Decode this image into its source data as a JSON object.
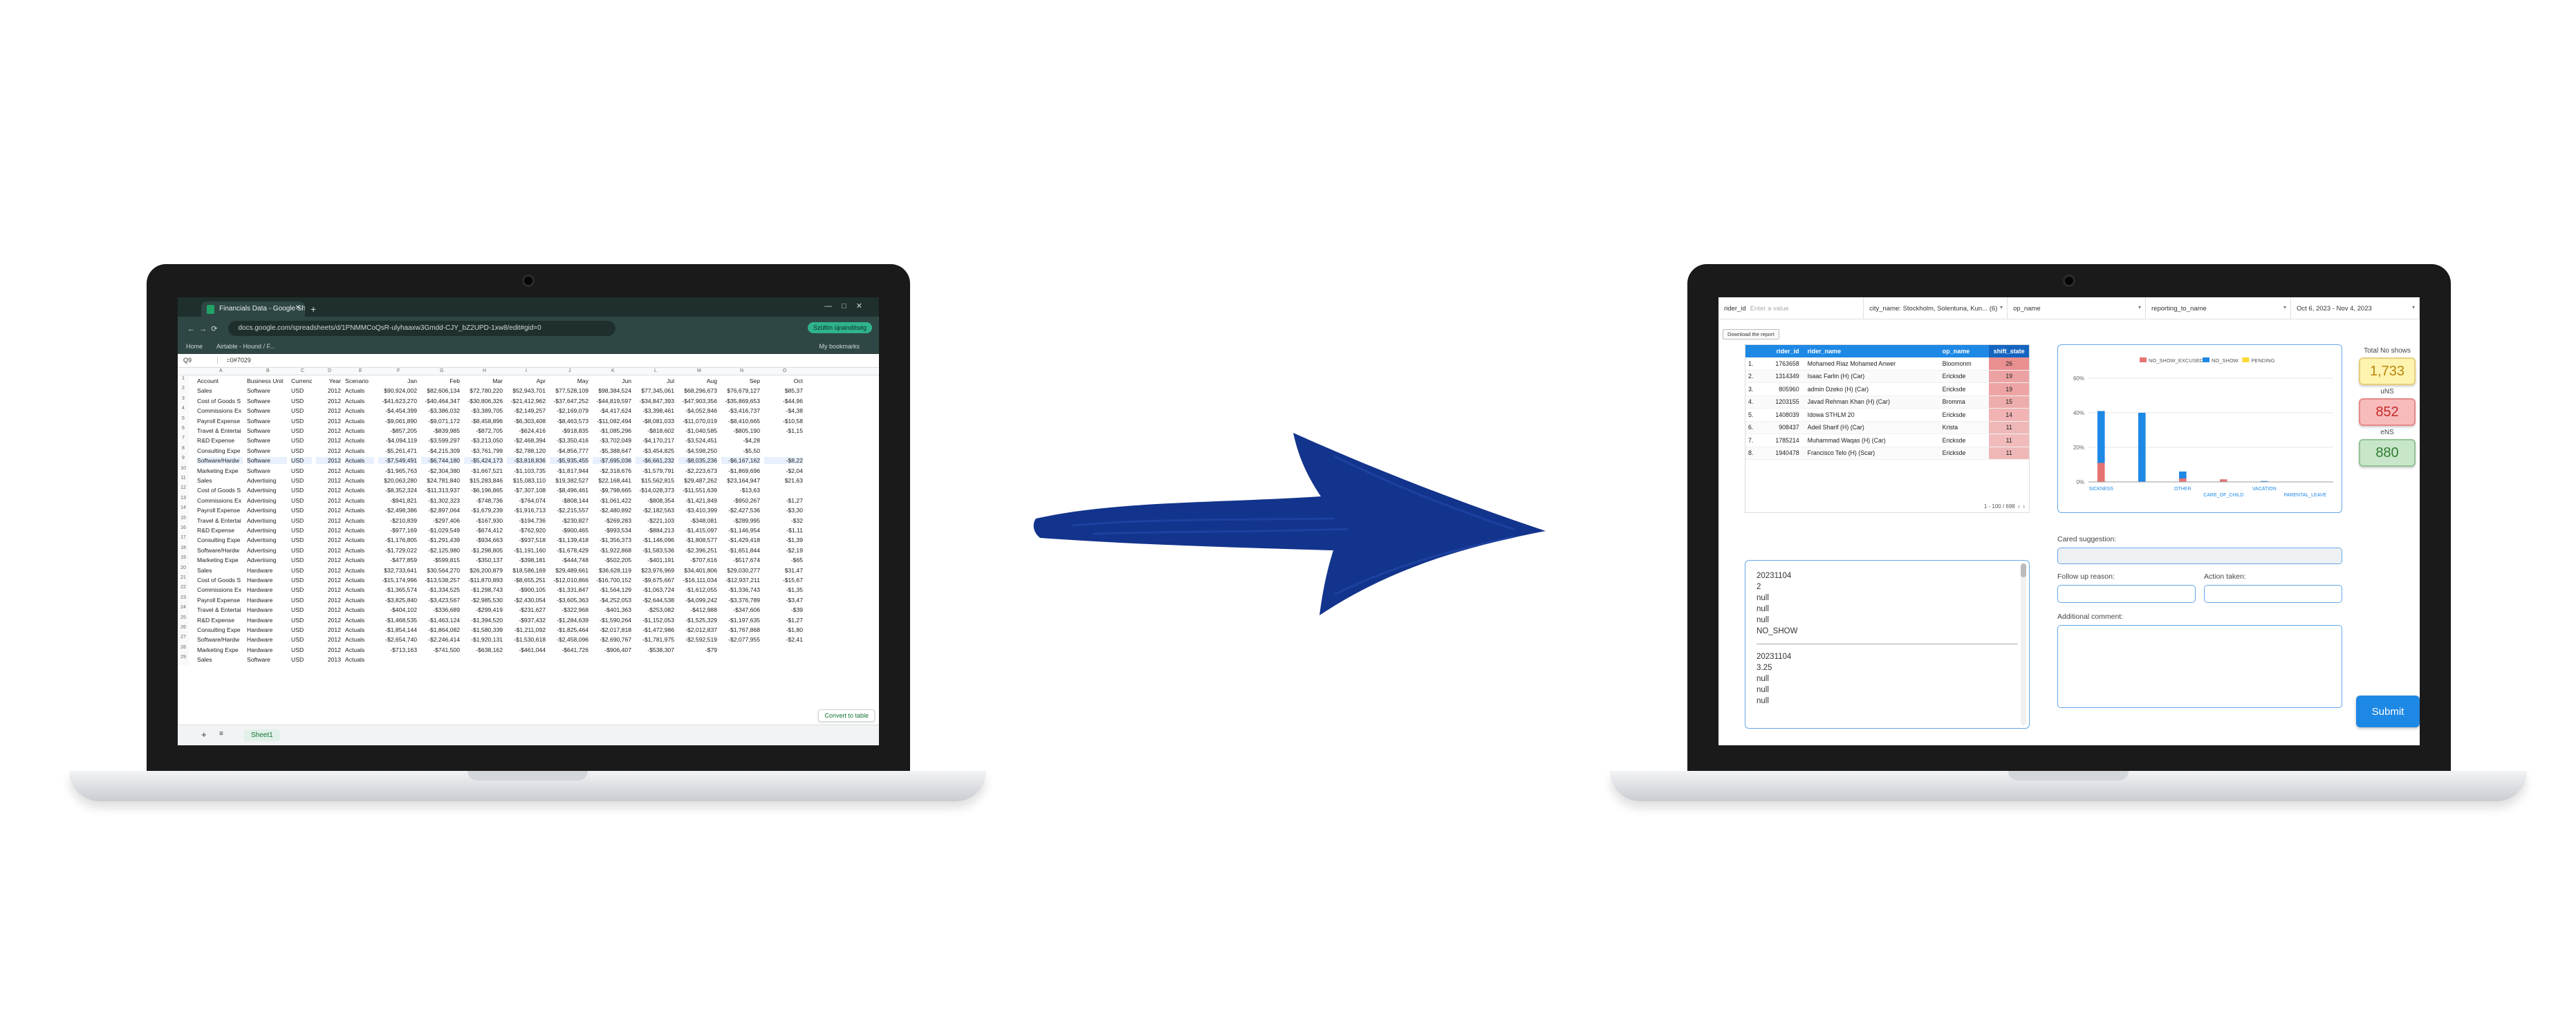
{
  "sheets": {
    "tab_title": "Financials Data - Google Sheets",
    "url": "docs.google.com/spreadsheets/d/1PNMMCoQsR-ulyhaaxw3Gmdd-CJY_bZ2UPD-1xw8/edit#gid=0",
    "profile_label": "Szüfön újraindítség",
    "bookmarks": [
      "Home",
      "Airtable - Hound / F..."
    ],
    "bookmarks_right": "My bookmarks",
    "cell_ref": "Q9",
    "formula": "=0#7029",
    "col_letters": [
      "A",
      "B",
      "C",
      "D",
      "E",
      "F",
      "G",
      "H",
      "I",
      "J",
      "K",
      "L",
      "M",
      "N",
      "O"
    ],
    "headers": [
      "Account",
      "Business Unit",
      "Currency",
      "Year",
      "Scenario",
      "Jan",
      "Feb",
      "Mar",
      "Apr",
      "May",
      "Jun",
      "Jul",
      "Aug",
      "Sep",
      "Oct"
    ],
    "rows": [
      [
        "Sales",
        "Software",
        "USD",
        "2012",
        "Actuals",
        "$90,924,002",
        "$82,606,134",
        "$72,780,220",
        "$52,943,701",
        "$77,528,109",
        "$98,384,524",
        "$77,345,061",
        "$68,296,673",
        "$76,679,127",
        "$85,37"
      ],
      [
        "Cost of Goods S",
        "Software",
        "USD",
        "2012",
        "Actuals",
        "-$41,623,270",
        "-$40,464,347",
        "-$30,806,326",
        "-$21,412,962",
        "-$37,647,252",
        "-$44,819,597",
        "-$34,847,393",
        "-$47,903,356",
        "-$35,869,653",
        "-$44,96"
      ],
      [
        "Commissions Ex",
        "Software",
        "USD",
        "2012",
        "Actuals",
        "-$4,454,399",
        "-$3,386,032",
        "-$3,389,705",
        "-$2,149,257",
        "-$2,169,079",
        "-$4,417,624",
        "-$3,398,461",
        "-$4,052,846",
        "-$3,416,737",
        "-$4,38"
      ],
      [
        "Payroll Expense",
        "Software",
        "USD",
        "2012",
        "Actuals",
        "-$9,061,890",
        "-$9,071,172",
        "-$8,458,896",
        "-$6,303,408",
        "-$8,463,573",
        "-$11,082,494",
        "-$8,081,033",
        "-$11,070,019",
        "-$8,410,665",
        "-$10,58"
      ],
      [
        "Travel & Entertai",
        "Software",
        "USD",
        "2012",
        "Actuals",
        "-$857,205",
        "-$839,985",
        "-$872,705",
        "-$624,416",
        "-$918,835",
        "-$1,085,296",
        "-$818,602",
        "-$1,040,585",
        "-$805,190",
        "-$1,15"
      ],
      [
        "R&D Expense",
        "Software",
        "USD",
        "2012",
        "Actuals",
        "-$4,094,119",
        "-$3,599,297",
        "-$3,213,050",
        "-$2,468,394",
        "-$3,350,416",
        "-$3,702,049",
        "-$4,170,217",
        "-$3,524,451",
        "-$4,28"
      ],
      [
        "Consulting Expe",
        "Software",
        "USD",
        "2012",
        "Actuals",
        "-$5,261,471",
        "-$4,215,309",
        "-$3,761,799",
        "-$2,788,120",
        "-$4,856,777",
        "-$5,388,647",
        "-$3,454,825",
        "-$4,598,250",
        "-$5,50"
      ],
      [
        "Software/Hardw",
        "Software",
        "USD",
        "2012",
        "Actuals",
        "-$7,549,491",
        "-$6,744,180",
        "-$5,424,173",
        "-$3,818,836",
        "-$5,935,455",
        "-$7,695,036",
        "-$6,661,232",
        "-$8,035,236",
        "-$6,167,162",
        "-$8,22"
      ],
      [
        "Marketing Expe",
        "Software",
        "USD",
        "2012",
        "Actuals",
        "-$1,965,763",
        "-$2,304,380",
        "-$1,667,521",
        "-$1,103,735",
        "-$1,817,944",
        "-$2,318,676",
        "-$1,579,791",
        "-$2,223,673",
        "-$1,869,696",
        "-$2,04"
      ],
      [
        "Sales",
        "Advertising",
        "USD",
        "2012",
        "Actuals",
        "$20,063,280",
        "$24,781,840",
        "$15,283,846",
        "$15,083,110",
        "$19,382,527",
        "$22,168,441",
        "$15,562,815",
        "$29,487,262",
        "$23,164,947",
        "$21,63"
      ],
      [
        "Cost of Goods S",
        "Advertising",
        "USD",
        "2012",
        "Actuals",
        "-$8,352,324",
        "-$11,313,937",
        "-$6,196,865",
        "-$7,307,108",
        "-$8,496,461",
        "-$9,798,665",
        "-$14,028,373",
        "-$11,551,639",
        "-$13,63"
      ],
      [
        "Commissions Ex",
        "Advertising",
        "USD",
        "2012",
        "Actuals",
        "-$941,821",
        "-$1,302,323",
        "-$748,736",
        "-$764,074",
        "-$808,144",
        "-$1,061,422",
        "-$808,354",
        "-$1,421,849",
        "-$950,267",
        "-$1,27"
      ],
      [
        "Payroll Expense",
        "Advertising",
        "USD",
        "2012",
        "Actuals",
        "-$2,498,386",
        "-$2,897,064",
        "-$1,679,239",
        "-$1,916,713",
        "-$2,215,557",
        "-$2,480,892",
        "-$2,182,563",
        "-$3,410,399",
        "-$2,427,536",
        "-$3,30"
      ],
      [
        "Travel & Entertai",
        "Advertising",
        "USD",
        "2012",
        "Actuals",
        "-$210,839",
        "-$297,406",
        "-$167,930",
        "-$194,736",
        "-$230,827",
        "-$269,283",
        "-$221,103",
        "-$348,081",
        "-$289,995",
        "-$32"
      ],
      [
        "R&D Expense",
        "Advertising",
        "USD",
        "2012",
        "Actuals",
        "-$977,169",
        "-$1,029,549",
        "-$674,412",
        "-$762,920",
        "-$900,465",
        "-$993,534",
        "-$884,213",
        "-$1,415,097",
        "-$1,146,954",
        "-$1,11"
      ],
      [
        "Consulting Expe",
        "Advertising",
        "USD",
        "2012",
        "Actuals",
        "-$1,176,805",
        "-$1,291,439",
        "-$934,663",
        "-$937,518",
        "-$1,139,418",
        "-$1,356,373",
        "-$1,146,096",
        "-$1,808,577",
        "-$1,429,418",
        "-$1,39"
      ],
      [
        "Software/Hardw",
        "Advertising",
        "USD",
        "2012",
        "Actuals",
        "-$1,729,022",
        "-$2,125,980",
        "-$1,298,805",
        "-$1,191,160",
        "-$1,678,429",
        "-$1,922,868",
        "-$1,583,536",
        "-$2,396,251",
        "-$1,651,844",
        "-$2,19"
      ],
      [
        "Marketing Expe",
        "Advertising",
        "USD",
        "2012",
        "Actuals",
        "-$477,859",
        "-$599,815",
        "-$350,137",
        "-$398,181",
        "-$444,748",
        "-$502,205",
        "-$401,191",
        "-$707,616",
        "-$517,674",
        "-$65"
      ],
      [
        "Sales",
        "Hardware",
        "USD",
        "2012",
        "Actuals",
        "$32,733,641",
        "$30,564,270",
        "$26,200,879",
        "$18,586,169",
        "$29,489,661",
        "$36,628,119",
        "$23,976,969",
        "$34,401,806",
        "$29,030,277",
        "$31,47"
      ],
      [
        "Cost of Goods S",
        "Hardware",
        "USD",
        "2012",
        "Actuals",
        "-$15,174,996",
        "-$13,538,257",
        "-$11,870,893",
        "-$8,655,251",
        "-$12,010,866",
        "-$16,700,152",
        "-$9,675,667",
        "-$16,111,034",
        "-$12,937,211",
        "-$15,67"
      ],
      [
        "Commissions Ex",
        "Hardware",
        "USD",
        "2012",
        "Actuals",
        "-$1,365,574",
        "-$1,334,525",
        "-$1,298,743",
        "-$900,105",
        "-$1,331,847",
        "-$1,564,129",
        "-$1,063,724",
        "-$1,612,055",
        "-$1,336,743",
        "-$1,35"
      ],
      [
        "Payroll Expense",
        "Hardware",
        "USD",
        "2012",
        "Actuals",
        "-$3,825,840",
        "-$3,423,567",
        "-$2,985,530",
        "-$2,430,054",
        "-$3,605,363",
        "-$4,252,053",
        "-$2,644,538",
        "-$4,099,242",
        "-$3,376,789",
        "-$3,47"
      ],
      [
        "Travel & Entertai",
        "Hardware",
        "USD",
        "2012",
        "Actuals",
        "-$404,102",
        "-$336,689",
        "-$299,419",
        "-$231,627",
        "-$322,968",
        "-$401,363",
        "-$253,082",
        "-$412,988",
        "-$347,606",
        "-$39"
      ],
      [
        "R&D Expense",
        "Hardware",
        "USD",
        "2012",
        "Actuals",
        "-$1,468,535",
        "-$1,463,124",
        "-$1,394,520",
        "-$937,432",
        "-$1,284,639",
        "-$1,590,264",
        "-$1,152,053",
        "-$1,525,329",
        "-$1,197,635",
        "-$1,27"
      ],
      [
        "Consulting Expe",
        "Hardware",
        "USD",
        "2012",
        "Actuals",
        "-$1,854,144",
        "-$1,864,082",
        "-$1,580,339",
        "-$1,211,092",
        "-$1,825,464",
        "-$2,017,818",
        "-$1,472,986",
        "-$2,012,837",
        "-$1,767,868",
        "-$1,80"
      ],
      [
        "Software/Hardw",
        "Hardware",
        "USD",
        "2012",
        "Actuals",
        "-$2,654,740",
        "-$2,246,414",
        "-$1,920,131",
        "-$1,530,618",
        "-$2,458,096",
        "-$2,690,767",
        "-$1,781,975",
        "-$2,592,519",
        "-$2,077,955",
        "-$2,41"
      ],
      [
        "Marketing Expe",
        "Hardware",
        "USD",
        "2012",
        "Actuals",
        "-$713,163",
        "-$741,500",
        "-$638,162",
        "-$461,044",
        "-$641,726",
        "-$906,407",
        "-$538,307",
        "-$79",
        "",
        ""
      ],
      [
        "Sales",
        "Software",
        "USD",
        "2013",
        "Actuals",
        "",
        "",
        "",
        "",
        "",
        "",
        "",
        "",
        "",
        ""
      ]
    ],
    "convert_label": "Convert to table",
    "sheet_tab": "Sheet1"
  },
  "dashboard": {
    "filters": [
      {
        "label": "rider_id",
        "placeholder": "Enter a value"
      },
      {
        "label": "city_name: Stockholm, Solentuna, Kun... (6)",
        "placeholder": ""
      },
      {
        "label": "op_name",
        "placeholder": ""
      },
      {
        "label": "reporting_to_name",
        "placeholder": ""
      },
      {
        "label": "Oct 6, 2023 - Nov 4, 2023",
        "placeholder": ""
      }
    ],
    "download_label": "Download the report",
    "table_headers": [
      "rider_id",
      "rider_name",
      "op_name",
      "shift_state"
    ],
    "table_rows": [
      [
        "1.",
        "1763658",
        "Mohamed Riaz Mohamed Anwer",
        "Bloomonm",
        "26"
      ],
      [
        "2.",
        "1314349",
        "Isaac Farlin (H) (Car)",
        "Ericksde",
        "19"
      ],
      [
        "3.",
        "805960",
        "admin Dzeko (H) (Car)",
        "Ericksde",
        "19"
      ],
      [
        "4.",
        "1203155",
        "Javad Rehman Khan (H) (Car)",
        "Bromma",
        "15"
      ],
      [
        "5.",
        "1408039",
        "Idowa STHLM 20",
        "Ericksde",
        "14"
      ],
      [
        "6.",
        "908437",
        "Adeil Sharif (H) (Car)",
        "Krista",
        "11"
      ],
      [
        "7.",
        "1785214",
        "Muhammad Waqas (H) (Car)",
        "Ericksde",
        "11"
      ],
      [
        "8.",
        "1940478",
        "Francisco Telo (H) (Scar)",
        "Ericksde",
        "11"
      ]
    ],
    "pager": "1 - 100 / 698",
    "chart_data": {
      "type": "bar",
      "stacked": true,
      "categories": [
        "SICKNESS",
        "",
        "OTHER",
        "CARE_OF_CHILD",
        "VACATION",
        "PARENTAL_LEAVE"
      ],
      "series": [
        {
          "name": "NO_SHOW_EXCUSED",
          "color": "#e57373",
          "values": [
            11,
            0,
            2,
            1.5,
            0,
            0.2
          ]
        },
        {
          "name": "NO_SHOW",
          "color": "#1e88e5",
          "values": [
            30,
            40,
            4,
            0,
            0.5,
            0
          ]
        },
        {
          "name": "PENDING",
          "color": "#fdd835",
          "values": [
            0,
            0,
            0,
            0,
            0,
            0
          ]
        }
      ],
      "yticks": [
        "0%",
        "20%",
        "40%",
        "60%"
      ],
      "ylim": [
        0,
        60
      ],
      "grid": true,
      "legend": "top"
    },
    "kpis": {
      "title": "Total No shows",
      "items": [
        {
          "value": "1,733",
          "label": "uNS",
          "bg": "#fff3b0",
          "fg": "#b8860b"
        },
        {
          "value": "852",
          "label": "eNS",
          "bg": "#f8bbbb",
          "fg": "#c62828"
        },
        {
          "value": "880",
          "label": "",
          "bg": "#c8e6c9",
          "fg": "#2e7d32"
        }
      ]
    },
    "list_blocks": [
      [
        "20231104",
        "2",
        "null",
        "null",
        "null",
        "NO_SHOW"
      ],
      [
        "20231104",
        "3.25",
        "null",
        "null",
        "null"
      ]
    ],
    "form": {
      "cared_label": "Cared suggestion:",
      "follow_label": "Follow up reason:",
      "action_label": "Action taken:",
      "comment_label": "Additional comment:",
      "submit_label": "Submit"
    }
  }
}
